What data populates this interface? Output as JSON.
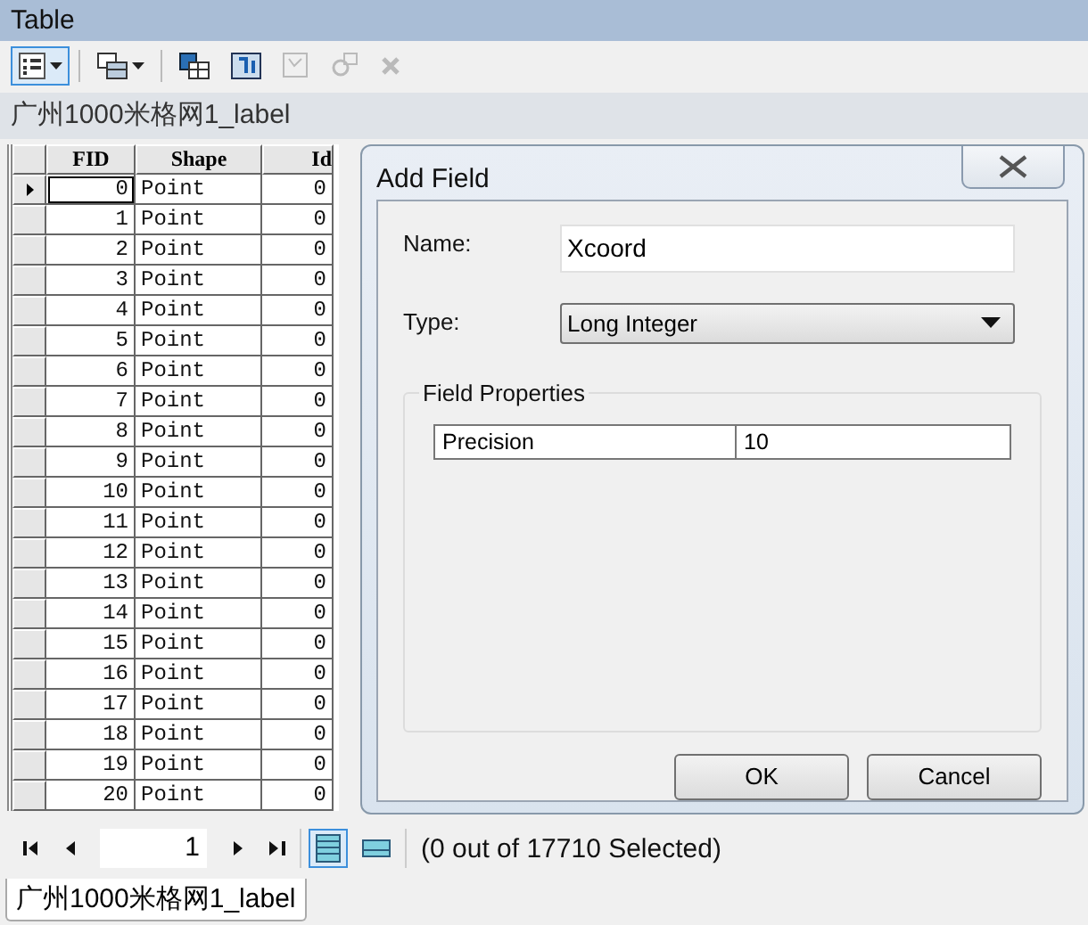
{
  "window": {
    "title": "Table"
  },
  "toolbar": [
    {
      "kind": "table-options",
      "selected": true,
      "disabled": false
    },
    {
      "kind": "related-tables",
      "selected": false,
      "disabled": false
    },
    {
      "kind": "select-by-attributes",
      "selected": false,
      "disabled": false
    },
    {
      "kind": "switch-selection",
      "selected": false,
      "disabled": false
    },
    {
      "kind": "clear-selection",
      "selected": false,
      "disabled": true
    },
    {
      "kind": "zoom-to-selected",
      "selected": false,
      "disabled": true
    },
    {
      "kind": "delete-selected",
      "selected": false,
      "disabled": true
    }
  ],
  "table_name": "广州1000米格网1_label",
  "table": {
    "columns": [
      "FID",
      "Shape",
      "Id"
    ],
    "rows": [
      {
        "cells": [
          "0",
          "Point",
          "0"
        ],
        "current": true
      },
      {
        "cells": [
          "1",
          "Point",
          "0"
        ],
        "current": false
      },
      {
        "cells": [
          "2",
          "Point",
          "0"
        ],
        "current": false
      },
      {
        "cells": [
          "3",
          "Point",
          "0"
        ],
        "current": false
      },
      {
        "cells": [
          "4",
          "Point",
          "0"
        ],
        "current": false
      },
      {
        "cells": [
          "5",
          "Point",
          "0"
        ],
        "current": false
      },
      {
        "cells": [
          "6",
          "Point",
          "0"
        ],
        "current": false
      },
      {
        "cells": [
          "7",
          "Point",
          "0"
        ],
        "current": false
      },
      {
        "cells": [
          "8",
          "Point",
          "0"
        ],
        "current": false
      },
      {
        "cells": [
          "9",
          "Point",
          "0"
        ],
        "current": false
      },
      {
        "cells": [
          "10",
          "Point",
          "0"
        ],
        "current": false
      },
      {
        "cells": [
          "11",
          "Point",
          "0"
        ],
        "current": false
      },
      {
        "cells": [
          "12",
          "Point",
          "0"
        ],
        "current": false
      },
      {
        "cells": [
          "13",
          "Point",
          "0"
        ],
        "current": false
      },
      {
        "cells": [
          "14",
          "Point",
          "0"
        ],
        "current": false
      },
      {
        "cells": [
          "15",
          "Point",
          "0"
        ],
        "current": false
      },
      {
        "cells": [
          "16",
          "Point",
          "0"
        ],
        "current": false
      },
      {
        "cells": [
          "17",
          "Point",
          "0"
        ],
        "current": false
      },
      {
        "cells": [
          "18",
          "Point",
          "0"
        ],
        "current": false
      },
      {
        "cells": [
          "19",
          "Point",
          "0"
        ],
        "current": false
      },
      {
        "cells": [
          "20",
          "Point",
          "0"
        ],
        "current": false
      }
    ]
  },
  "dialog": {
    "title": "Add Field",
    "name_label": "Name:",
    "name_value": "Xcoord",
    "type_label": "Type:",
    "type_value": "Long Integer",
    "group_title": "Field Properties",
    "properties": [
      {
        "name": "Precision",
        "value": "10"
      }
    ],
    "buttons": [
      "OK",
      "Cancel"
    ]
  },
  "navigation": {
    "record": "1",
    "views": [
      {
        "kind": "all",
        "selected": true
      },
      {
        "kind": "selected",
        "selected": false
      }
    ],
    "status": "(0 out of 17710 Selected)"
  },
  "tabs": [
    {
      "label": "广州1000米格网1_label",
      "selected": true
    }
  ]
}
